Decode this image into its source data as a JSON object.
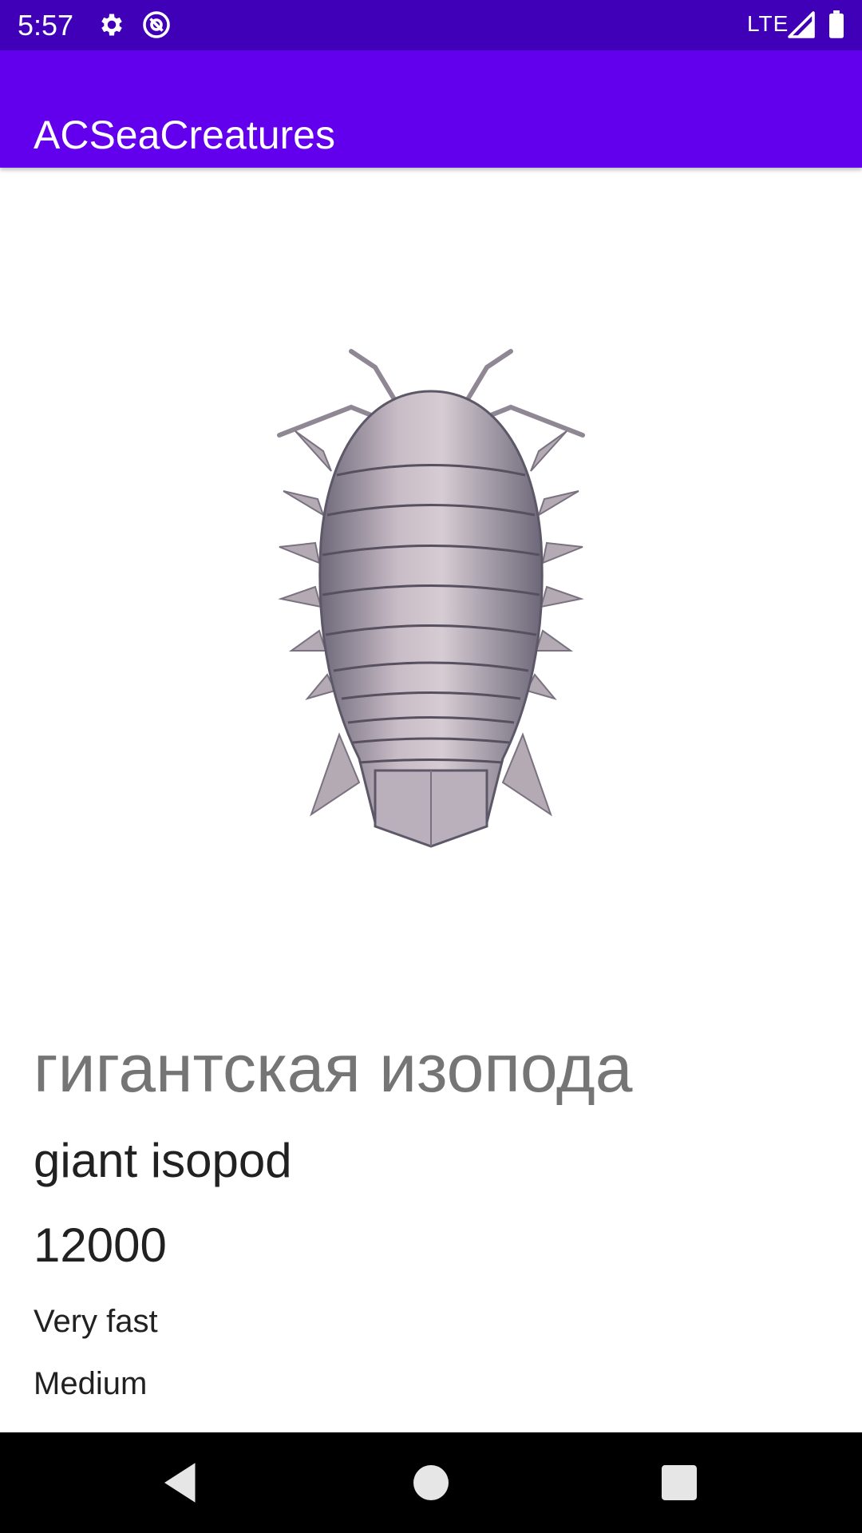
{
  "status_bar": {
    "time": "5:57",
    "network": "LTE",
    "icons": [
      "gear-icon",
      "at-sign-icon",
      "signal-icon",
      "battery-icon"
    ]
  },
  "app_bar": {
    "title": "ACSeaCreatures"
  },
  "creature": {
    "image_icon": "giant-isopod-image",
    "name_ru": "гигантская изопода",
    "name_en": "giant isopod",
    "price": "12000",
    "speed": "Very fast",
    "size": "Medium"
  },
  "nav_bar": {
    "icons": [
      "back-icon",
      "home-icon",
      "recents-icon"
    ]
  },
  "colors": {
    "status_bar": "#3f00b8",
    "app_bar": "#6200ee",
    "nav_bar": "#000000",
    "primary_text": "#212121",
    "secondary_text": "#757575"
  }
}
